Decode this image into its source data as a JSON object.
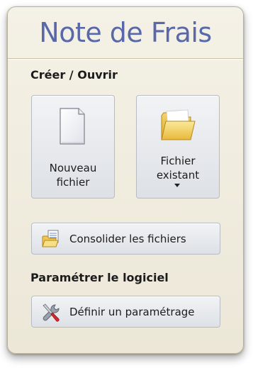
{
  "panel": {
    "title": "Note de Frais"
  },
  "section_create": {
    "heading": "Créer / Ouvrir",
    "new_file": {
      "label_line1": "Nouveau",
      "label_line2": "fichier",
      "icon": "document-icon"
    },
    "existing_file": {
      "label_line1": "Fichier",
      "label_line2": "existant",
      "icon": "folder-icon"
    },
    "consolidate": {
      "label": "Consolider les fichiers",
      "icon": "consolidate-icon"
    }
  },
  "section_settings": {
    "heading": "Paramétrer le logiciel",
    "define_settings": {
      "label": "Définir un paramétrage",
      "icon": "tools-icon"
    }
  },
  "colors": {
    "title": "#5968a9",
    "panel_background": "#f4f1e6",
    "button_background": "#e7eaee"
  }
}
